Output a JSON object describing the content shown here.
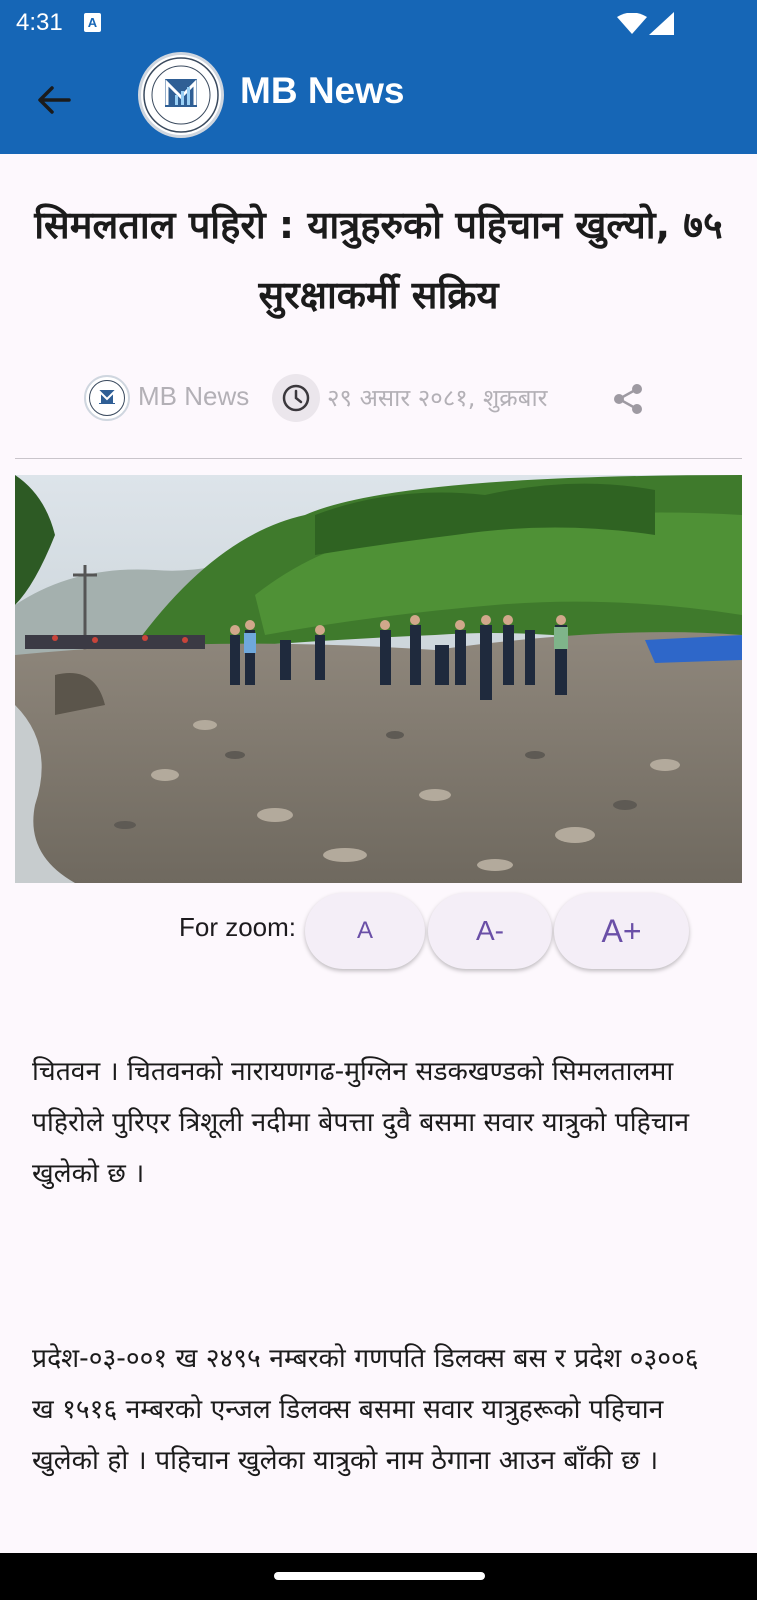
{
  "status_bar": {
    "time": "4:31",
    "notification_icon": "a-icon"
  },
  "app_bar": {
    "title": "MB News",
    "back_icon": "arrow-left-icon",
    "logo_icon": "mb-logo"
  },
  "colors": {
    "primary": "#1666b6",
    "background": "#fdf8fd",
    "zoom_text": "#6a4fa7",
    "meta_text": "#b3b0b6"
  },
  "article": {
    "headline": "सिमलताल पहिरो : यात्रुहरुको पहिचान खुल्यो, ७५ सुरक्षाकर्मी सक्रिय",
    "source": "MB News",
    "date": "२९ असार २०८१, शुक्रबार",
    "paragraphs": [
      "चितवन । चितवनको नारायणगढ-मुग्लिन सडकखण्डको सिमलतालमा पहिरोले पुरिएर त्रिशूली नदीमा बेपत्ता दुवै बसमा सवार यात्रुको पहिचान खुलेको छ ।",
      "प्रदेश-०३-००१ ख २४९५ नम्बरको गणपति डिलक्स बस र प्रदेश ०३००६ ख १५१६ नम्बरको एन्जल डिलक्स बसमा सवार यात्रुहरूको पहिचान खुलेको हो । पहिचान खुलेका यात्रुको नाम ठेगाना आउन बाँकी छ ।"
    ]
  },
  "zoom": {
    "label": "For zoom:",
    "reset_label": "A",
    "decrease_label": "A-",
    "increase_label": "A+"
  }
}
